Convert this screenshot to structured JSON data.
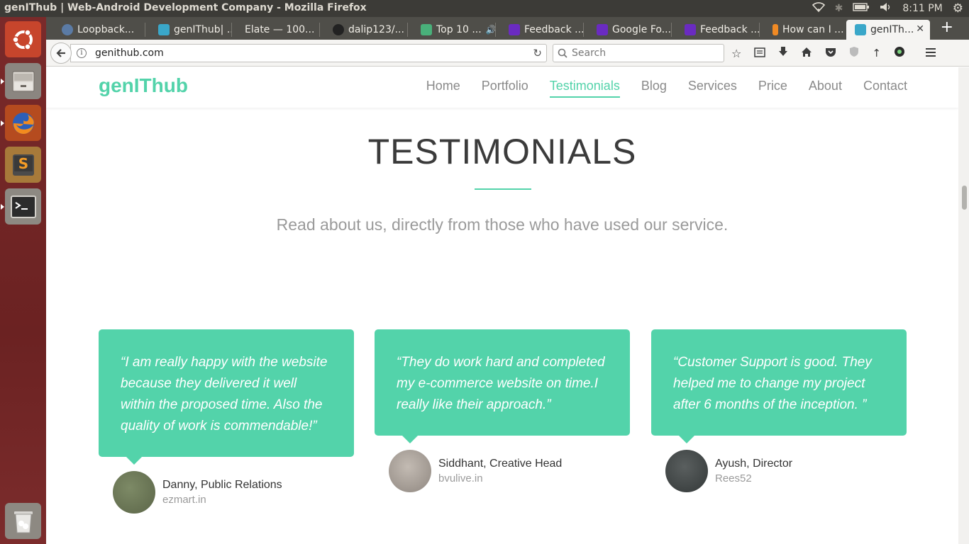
{
  "os": {
    "window_title": "genIThub | Web-Android Development Company - Mozilla Firefox",
    "clock": "8:11 PM"
  },
  "tabs": [
    {
      "label": "Loopback...",
      "favicon_color": "#5b7ba5"
    },
    {
      "label": "genIThub| ...",
      "favicon_color": "#3aa7c9"
    },
    {
      "label": "Elate — 100...",
      "favicon_color": ""
    },
    {
      "label": "dalip123/...",
      "favicon_color": "#222222"
    },
    {
      "label": "Top 10 ...",
      "favicon_color": "#49b07a"
    },
    {
      "label": "Feedback ...",
      "favicon_color": "#6a2bc1"
    },
    {
      "label": "Google Fo...",
      "favicon_color": "#6a2bc1"
    },
    {
      "label": "Feedback ...",
      "favicon_color": "#6a2bc1"
    },
    {
      "label": "How can I ...",
      "favicon_color": "#f08a24"
    },
    {
      "label": "genITh...",
      "favicon_color": "#3aa7c9"
    }
  ],
  "browser": {
    "url": "genithub.com",
    "search_placeholder": "Search"
  },
  "site": {
    "logo": "genIThub",
    "menu": [
      {
        "label": "Home"
      },
      {
        "label": "Portfolio"
      },
      {
        "label": "Testimonials"
      },
      {
        "label": "Blog"
      },
      {
        "label": "Services"
      },
      {
        "label": "Price"
      },
      {
        "label": "About"
      },
      {
        "label": "Contact"
      }
    ],
    "active_menu": "Testimonials",
    "accent_color": "#53d3aa",
    "heading": "TESTIMONIALS",
    "subtitle": "Read about us, directly from those who have used our service.",
    "testimonials": [
      {
        "quote": "“I am really happy with the website because they delivered it well within the proposed time. Also the quality of work is commendable!”",
        "name": "Danny, Public Relations",
        "site": "ezmart.in",
        "avatar_color": "#6b7757"
      },
      {
        "quote": "“They do work hard and completed my e-commerce website on time.I really like their approach.”",
        "name": "Siddhant, Creative Head",
        "site": "bvulive.in",
        "avatar_color": "#a49d96"
      },
      {
        "quote": "“Customer Support is good. They helped me to change my project after 6 months of the inception. ”",
        "name": "Ayush, Director",
        "site": "Rees52",
        "avatar_color": "#454a4a"
      }
    ]
  }
}
